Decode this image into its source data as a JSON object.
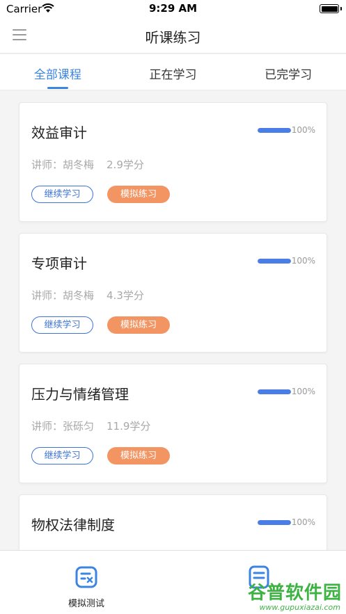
{
  "status_bar": {
    "carrier": "Carrier",
    "time": "9:29 AM"
  },
  "nav": {
    "title": "听课练习",
    "menu_icon": "hamburger-menu-icon"
  },
  "tabs": [
    {
      "label": "全部课程",
      "active": true
    },
    {
      "label": "正在学习",
      "active": false
    },
    {
      "label": "已完学习",
      "active": false
    }
  ],
  "courses": [
    {
      "title": "效益审计",
      "progress": 100,
      "progress_label": "100%",
      "teacher": "讲师：胡冬梅",
      "credits": "2.9学分",
      "continue_label": "继续学习",
      "practice_label": "模拟练习"
    },
    {
      "title": "专项审计",
      "progress": 100,
      "progress_label": "100%",
      "teacher": "讲师：胡冬梅",
      "credits": "4.3学分",
      "continue_label": "继续学习",
      "practice_label": "模拟练习"
    },
    {
      "title": "压力与情绪管理",
      "progress": 100,
      "progress_label": "100%",
      "teacher": "讲师：张砾匀",
      "credits": "11.9学分",
      "continue_label": "继续学习",
      "practice_label": "模拟练习"
    },
    {
      "title": "物权法律制度",
      "progress": 100,
      "progress_label": "100%",
      "teacher": "",
      "credits": "",
      "continue_label": "",
      "practice_label": ""
    }
  ],
  "tabbar": [
    {
      "label": "模拟测试",
      "icon": "mock-test-icon"
    },
    {
      "label": "",
      "icon": "document-icon"
    }
  ],
  "watermark": {
    "text": "谷普软件园",
    "url": "www.gupuxiazai.com"
  },
  "colors": {
    "accent": "#3b84e0",
    "progress": "#4a7ee6",
    "practice_button": "#f39563",
    "continue_border": "#3e73d8",
    "watermark": "#3eb243"
  }
}
